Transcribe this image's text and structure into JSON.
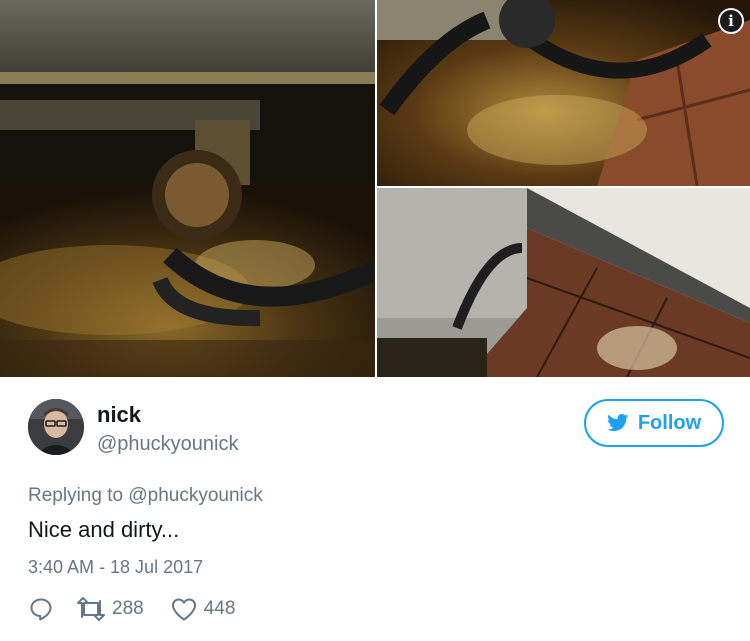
{
  "photos": {
    "info_badge": "i"
  },
  "tweet": {
    "display_name": "nick",
    "handle": "@phuckyounick",
    "replying_prefix": "Replying to ",
    "replying_to": "@phuckyounick",
    "text": "Nice and dirty...",
    "timestamp": "3:40 AM - 18 Jul 2017",
    "retweets": "288",
    "likes": "448"
  },
  "follow_button": {
    "label": "Follow"
  },
  "icons": {
    "follow": "twitter-bird-icon",
    "reply": "reply-icon",
    "retweet": "retweet-icon",
    "like": "heart-icon"
  },
  "colors": {
    "accent": "#1da1f2",
    "secondary_text": "#657786",
    "primary_text": "#14171a"
  }
}
